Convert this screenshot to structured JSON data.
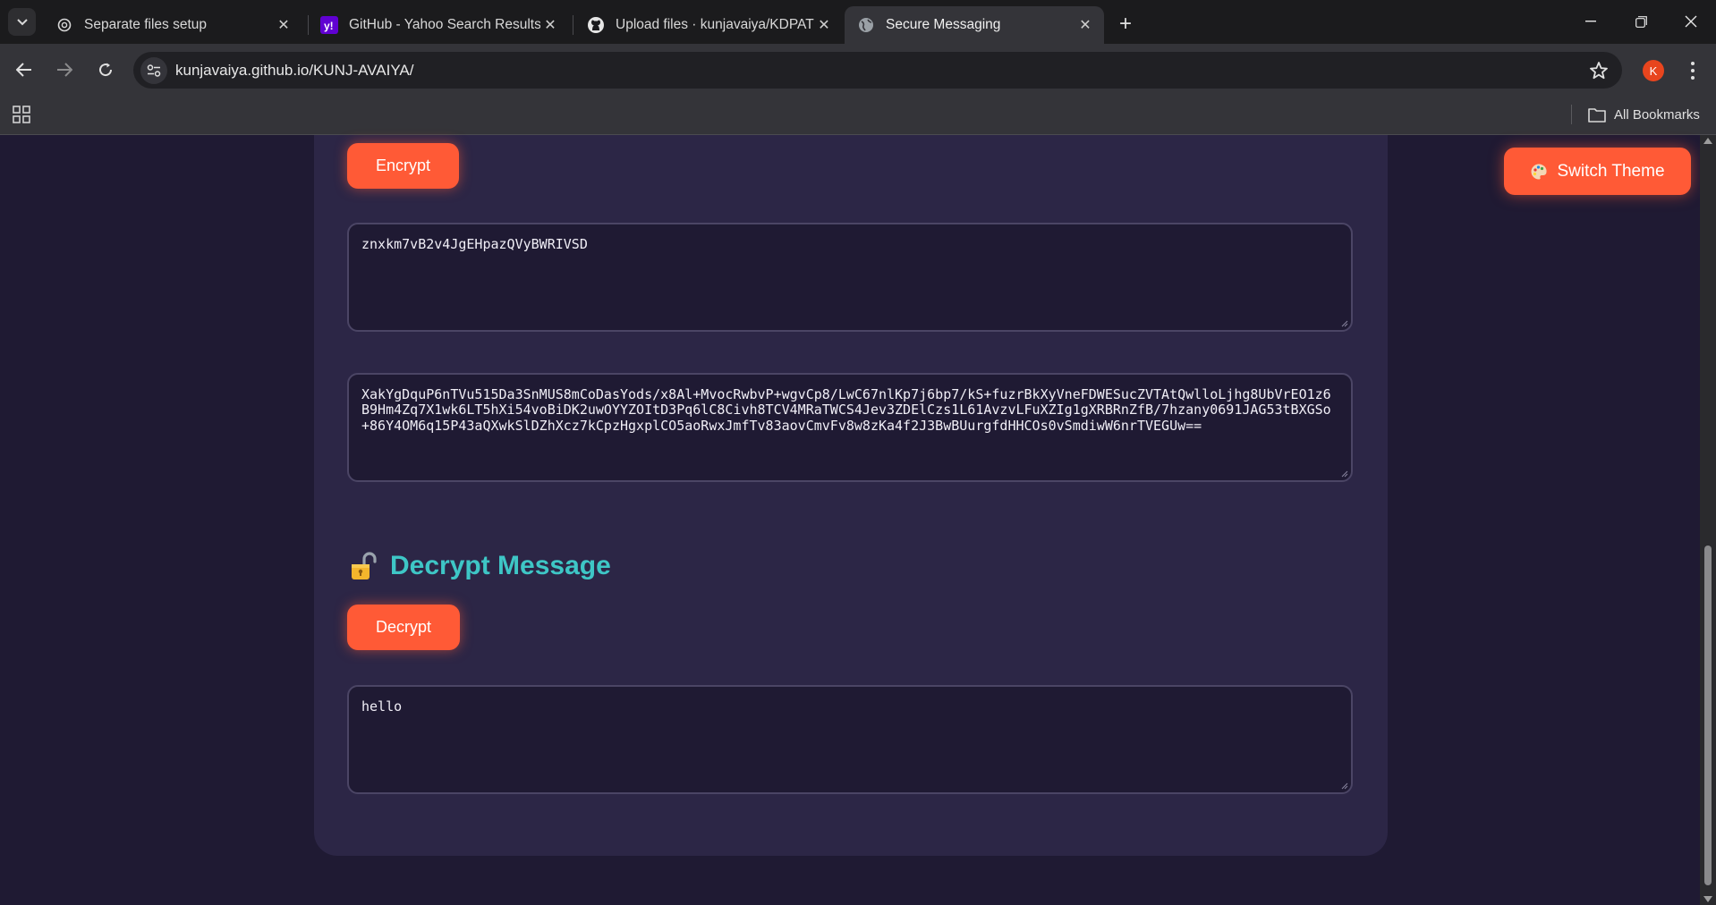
{
  "browser": {
    "tabs": [
      {
        "title": "Separate files setup",
        "icon": "openai-icon",
        "active": false
      },
      {
        "title": "GitHub - Yahoo Search Results",
        "icon": "yahoo-icon",
        "active": false
      },
      {
        "title": "Upload files · kunjavaiya/KDPAT",
        "icon": "github-icon",
        "active": false
      },
      {
        "title": "Secure Messaging",
        "icon": "globe-icon",
        "active": true
      }
    ],
    "url": "kunjavaiya.github.io/KUNJ-AVAIYA/",
    "profile_initial": "K",
    "bookmarks_label": "All Bookmarks"
  },
  "page": {
    "encrypt_button": "Encrypt",
    "key_value": "znxkm7vB2v4JgEHpazQVyBWRIVSD",
    "ciphertext_value": "XakYgDquP6nTVu515Da3SnMUS8mCoDasYods/x8Al+MvocRwbvP+wgvCp8/LwC67nlKp7j6bp7/kS+fuzrBkXyVneFDWESucZVTAtQwlloLjhg8UbVrEO1z6B9Hm4Zq7X1wk6LT5hXi54voBiDK2uwOYYZOItD3Pq6lC8Civh8TCV4MRaTWCS4Jev3ZDElCzs1L61AvzvLFuXZIg1gXRBRnZfB/7hzany0691JAG53tBXGSo+86Y4OM6q15P43aQXwkSlDZhXcz7kCpzHgxplCO5aoRwxJmfTv83aovCmvFv8w8zKa4f2J3BwBUurgfdHHCOs0vSmdiwW6nrTVEGUw==",
    "decrypt_section_title": "Decrypt Message",
    "decrypt_icon": "unlocked-padlock-icon",
    "decrypt_button": "Decrypt",
    "decrypted_value": "hello",
    "switch_theme_button": "Switch Theme",
    "switch_theme_icon": "palette-icon"
  },
  "colors": {
    "page_bg": "#1f1a33",
    "card_bg": "#2c2646",
    "accent_button": "#ff5a36",
    "heading_teal": "#3ec6c6"
  }
}
